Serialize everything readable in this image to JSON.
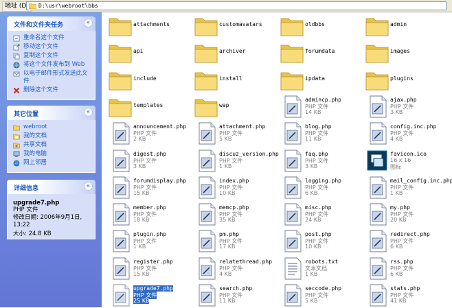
{
  "addressbar": {
    "label": "地址 (D)",
    "path": "D:\\usr\\webroot\\bbs"
  },
  "tasks": {
    "title": "文件和文件夹任务",
    "items": [
      {
        "label": "重命名这个文件",
        "icon": "rename-icon"
      },
      {
        "label": "移动这个文件",
        "icon": "move-icon"
      },
      {
        "label": "复制这个文件",
        "icon": "copy-icon"
      },
      {
        "label": "将这个文件发布到 Web",
        "icon": "publish-web-icon"
      },
      {
        "label": "以电子邮件形式发送此文件",
        "icon": "email-icon"
      },
      {
        "label": "删除这个文件",
        "icon": "delete-icon"
      }
    ]
  },
  "places": {
    "title": "其它位置",
    "items": [
      {
        "label": "webroot",
        "icon": "folder-icon"
      },
      {
        "label": "我的文档",
        "icon": "my-documents-icon"
      },
      {
        "label": "共享文档",
        "icon": "shared-documents-icon"
      },
      {
        "label": "我的电脑",
        "icon": "my-computer-icon"
      },
      {
        "label": "网上邻居",
        "icon": "network-icon"
      }
    ]
  },
  "details": {
    "title": "详细信息",
    "name": "upgrade7.php",
    "type": "PHP 文件",
    "modified": "修改日期: 2006年9月1日, 13:22",
    "size": "大小: 24.8 KB"
  },
  "files": [
    {
      "name": "attachments",
      "kind": "folder"
    },
    {
      "name": "customavatars",
      "kind": "folder"
    },
    {
      "name": "oldbbs",
      "kind": "folder"
    },
    {
      "name": "admin",
      "kind": "folder"
    },
    {
      "name": "api",
      "kind": "folder"
    },
    {
      "name": "archiver",
      "kind": "folder"
    },
    {
      "name": "forumdata",
      "kind": "folder"
    },
    {
      "name": "images",
      "kind": "folder"
    },
    {
      "name": "include",
      "kind": "folder"
    },
    {
      "name": "install",
      "kind": "folder"
    },
    {
      "name": "ipdata",
      "kind": "folder"
    },
    {
      "name": "plugins",
      "kind": "folder"
    },
    {
      "name": "templates",
      "kind": "folder"
    },
    {
      "name": "wap",
      "kind": "folder"
    },
    {
      "name": "admincp.php",
      "kind": "php",
      "type": "PHP 文件",
      "size": "14 KB"
    },
    {
      "name": "ajax.php",
      "kind": "php",
      "type": "PHP 文件",
      "size": "3 KB"
    },
    {
      "name": "announcement.php",
      "kind": "php",
      "type": "PHP 文件",
      "size": "2 KB"
    },
    {
      "name": "attachment.php",
      "kind": "php",
      "type": "PHP 文件",
      "size": "5 KB"
    },
    {
      "name": "blog.php",
      "kind": "php",
      "type": "PHP 文件",
      "size": "11 KB"
    },
    {
      "name": "config.inc.php",
      "kind": "php",
      "type": "PHP 文件",
      "size": "4 KB"
    },
    {
      "name": "digest.php",
      "kind": "php",
      "type": "PHP 文件",
      "size": "3 KB"
    },
    {
      "name": "discuz_version.php",
      "kind": "php",
      "type": "PHP 文件",
      "size": "1 KB"
    },
    {
      "name": "faq.php",
      "kind": "php",
      "type": "PHP 文件",
      "size": "3 KB"
    },
    {
      "name": "favicon.ico",
      "kind": "ico",
      "type": "16 x 16",
      "size": "图标"
    },
    {
      "name": "forumdisplay.php",
      "kind": "php",
      "type": "PHP 文件",
      "size": "15 KB"
    },
    {
      "name": "index.php",
      "kind": "php",
      "type": "PHP 文件",
      "size": "10 KB"
    },
    {
      "name": "logging.php",
      "kind": "php",
      "type": "PHP 文件",
      "size": "6 KB"
    },
    {
      "name": "mail_config.inc.php",
      "kind": "php",
      "type": "PHP 文件",
      "size": "1 KB"
    },
    {
      "name": "member.php",
      "kind": "php",
      "type": "PHP 文件",
      "size": "18 KB"
    },
    {
      "name": "memcp.php",
      "kind": "php",
      "type": "PHP 文件",
      "size": "35 KB"
    },
    {
      "name": "misc.php",
      "kind": "php",
      "type": "PHP 文件",
      "size": "24 KB"
    },
    {
      "name": "my.php",
      "kind": "php",
      "type": "PHP 文件",
      "size": "20 KB"
    },
    {
      "name": "plugin.php",
      "kind": "php",
      "type": "PHP 文件",
      "size": "1 KB"
    },
    {
      "name": "pm.php",
      "kind": "php",
      "type": "PHP 文件",
      "size": "17 KB"
    },
    {
      "name": "post.php",
      "kind": "php",
      "type": "PHP 文件",
      "size": "10 KB"
    },
    {
      "name": "redirect.php",
      "kind": "php",
      "type": "PHP 文件",
      "size": "6 KB"
    },
    {
      "name": "register.php",
      "kind": "php",
      "type": "PHP 文件",
      "size": "15 KB"
    },
    {
      "name": "relatethread.php",
      "kind": "php",
      "type": "PHP 文件",
      "size": "4 KB"
    },
    {
      "name": "robots.txt",
      "kind": "txt",
      "type": "文本文档",
      "size": "1 KB"
    },
    {
      "name": "rss.php",
      "kind": "php",
      "type": "PHP 文件",
      "size": "6 KB"
    },
    {
      "name": "upgrade7.php",
      "kind": "php",
      "type": "PHP 文件",
      "size": "25 KB",
      "selected": true
    },
    {
      "name": "search.php",
      "kind": "php",
      "type": "PHP 文件",
      "size": "11 KB"
    },
    {
      "name": "seccode.php",
      "kind": "php",
      "type": "PHP 文件",
      "size": "5 KB"
    },
    {
      "name": "stats.php",
      "kind": "php",
      "type": "PHP 文件",
      "size": "41 KB"
    }
  ],
  "colors": {
    "taskpane_top": "#7ba2e7",
    "taskpane_bottom": "#6375d6",
    "panel_title": "#215dc6",
    "selection": "#316ac5",
    "folder_yellow": "#f5d35f"
  }
}
